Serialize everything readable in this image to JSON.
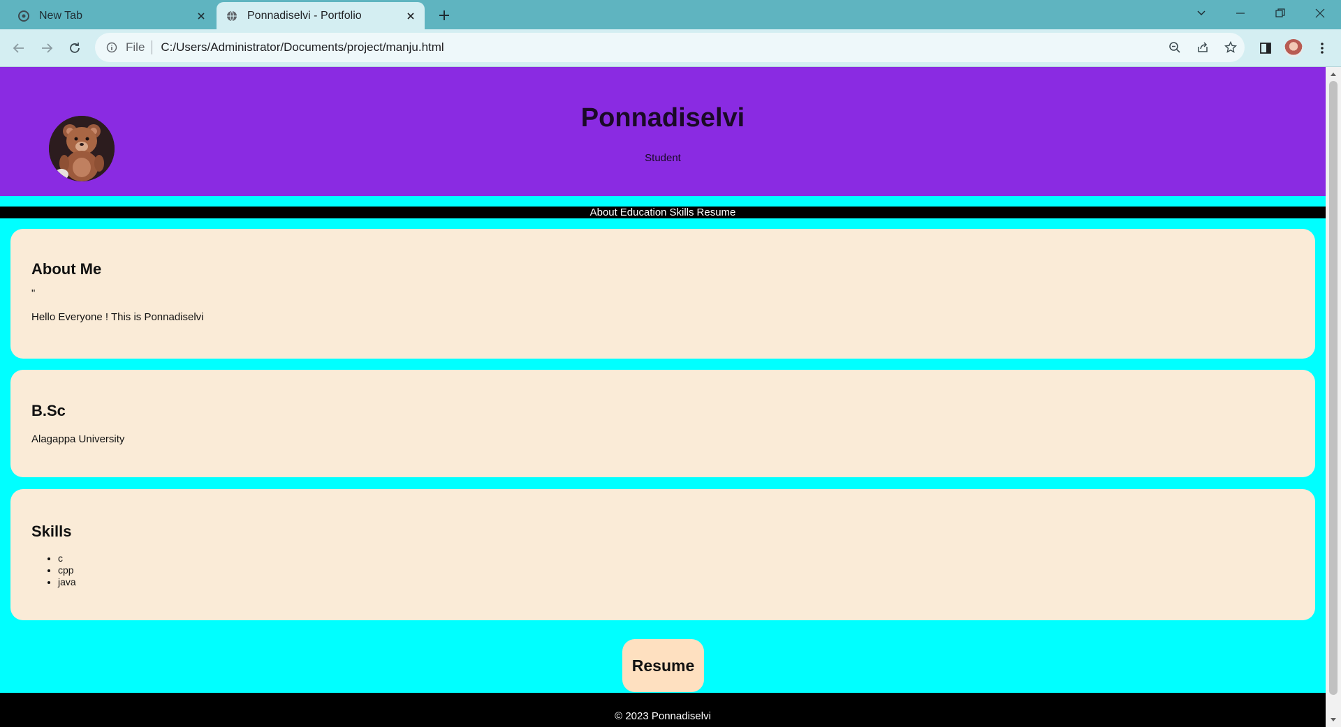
{
  "browser": {
    "tabs": [
      {
        "title": "New Tab",
        "active": false
      },
      {
        "title": "Ponnadiselvi - Portfolio",
        "active": true
      }
    ],
    "address_bar": {
      "scheme_label": "File",
      "url": "C:/Users/Administrator/Documents/project/manju.html"
    }
  },
  "header": {
    "name": "Ponnadiselvi",
    "role": "Student",
    "profile_image_icon": "teddy-bear"
  },
  "nav": {
    "items": [
      "About",
      "Education",
      "Skills",
      "Resume"
    ]
  },
  "about": {
    "heading": "About Me",
    "quote_mark": "\"",
    "text": "Hello Everyone ! This is Ponnadiselvi"
  },
  "education": {
    "heading": "B.Sc",
    "institution": "Alagappa University"
  },
  "skills": {
    "heading": "Skills",
    "items": [
      "c",
      "cpp",
      "java"
    ]
  },
  "resume": {
    "button_label": "Resume"
  },
  "footer": {
    "text": "© 2023 Ponnadiselvi"
  },
  "colors": {
    "header_bg": "#8a2be2",
    "page_bg": "#00ffff",
    "card_bg": "#faebd7",
    "nav_bg": "#000000",
    "footer_bg": "#000000",
    "resume_button_bg": "#fee0c0",
    "tabbar_bg": "#5fb4c0"
  }
}
